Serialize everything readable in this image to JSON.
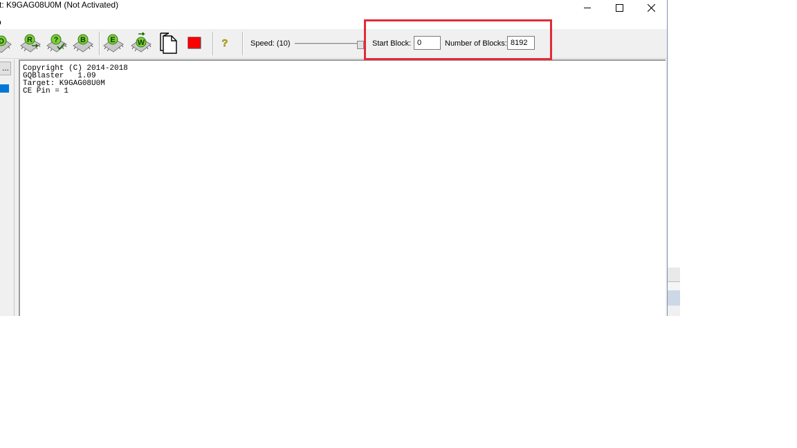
{
  "window": {
    "title": "t: K9GAG08U0M (Not Activated)"
  },
  "menu": {
    "items": [
      {
        "label": "p"
      }
    ]
  },
  "toolbar": {
    "buttons": [
      {
        "letter": "D"
      },
      {
        "letter": "R"
      },
      {
        "letter": "?"
      },
      {
        "letter": "B"
      },
      {
        "letter": "E"
      },
      {
        "letter": "W"
      }
    ],
    "help_label": "?",
    "speed_label": "Speed: (10)",
    "speed_value": 10,
    "speed_max": 10,
    "start_block_label": "Start Block:",
    "start_block_value": "0",
    "num_blocks_label": "Number of Blocks:",
    "num_blocks_value": "8192"
  },
  "left_panel": {
    "browse_label": "..."
  },
  "log": {
    "lines": [
      "Copyright (C) 2014-2018",
      "GQBlaster   1.09",
      "Target: K9GAG08U0M",
      "CE Pin = 1"
    ]
  },
  "colors": {
    "highlight": "#e12b38",
    "selection": "#0078d7",
    "stop_red": "#ff0000"
  }
}
